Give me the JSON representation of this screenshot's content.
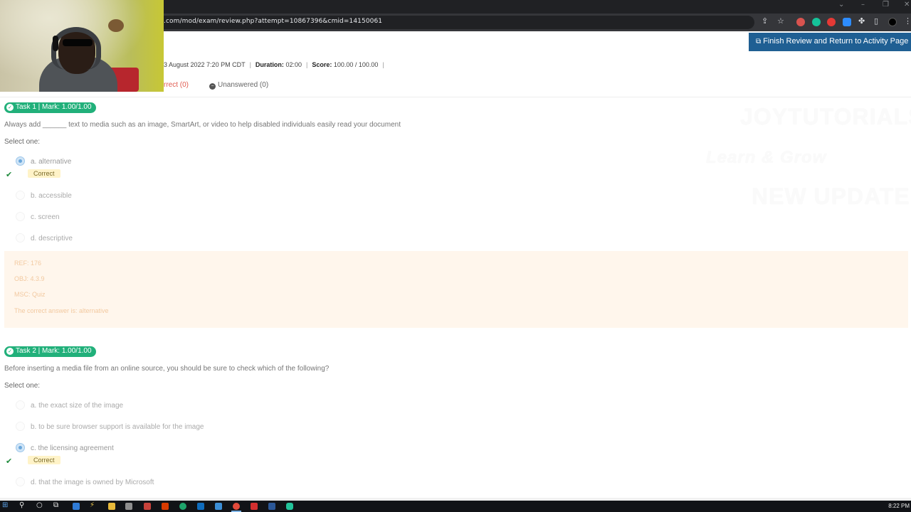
{
  "browser": {
    "url": ".com/mod/exam/review.php?attempt=10867396&cmid=14150061",
    "window_controls": [
      "⌄",
      "–",
      "❐",
      "✕"
    ],
    "extension_icons": [
      "share-icon",
      "star-icon",
      "shield-icon",
      "grammarly-icon",
      "adblock-icon",
      "zoom-icon",
      "puzzle-icon",
      "sidebar-icon",
      "profile-icon",
      "menu-icon"
    ]
  },
  "header": {
    "finish_button": "Finish Review and Return to Activity Page",
    "started_fragment": "3 August 2022 7:20 PM CDT",
    "duration_label": "Duration:",
    "duration_value": "02:00",
    "score_label": "Score:",
    "score_value": "100.00 / 100.00",
    "filter_incorrect": "rrect (0)",
    "filter_unanswered": "Unanswered (0)"
  },
  "watermark": {
    "line1": "JOYTUTORIALS",
    "line2": "Learn & Grow",
    "line3": "NEW UPDATE"
  },
  "tasks": [
    {
      "badge": "Task 1 | Mark: 1.00/1.00",
      "question": "Always add ______ text to media such as an image, SmartArt, or video to help disabled individuals easily read your document",
      "select_one": "Select one:",
      "options": [
        "a. alternative",
        "b. accessible",
        "c. screen",
        "d. descriptive"
      ],
      "selected_index": 0,
      "correct_label": "Correct",
      "feedback": [
        "REF: 176",
        "OBJ: 4.3.9",
        "MSC: Quiz",
        "The correct answer is: alternative"
      ]
    },
    {
      "badge": "Task 2 | Mark: 1.00/1.00",
      "question": "Before inserting a media file from an online source, you should be sure to check which of the following?",
      "select_one": "Select one:",
      "options": [
        "a. the exact size of the image",
        "b. to be sure browser support is available for the image",
        "c. the licensing agreement",
        "d. that the image is owned by Microsoft"
      ],
      "selected_index": 2,
      "correct_label": "Correct"
    }
  ],
  "taskbar": {
    "time": "8:22 PM",
    "icons": [
      "windows-start-icon",
      "search-icon",
      "cortana-icon",
      "task-view-icon",
      "mail-icon",
      "file-explorer-icon",
      "calculator-icon",
      "snip-icon",
      "office-icon",
      "edge-icon",
      "outlook-icon",
      "photos-icon",
      "chrome-icon",
      "acrobat-icon",
      "word-icon",
      "camera-app-icon"
    ]
  }
}
